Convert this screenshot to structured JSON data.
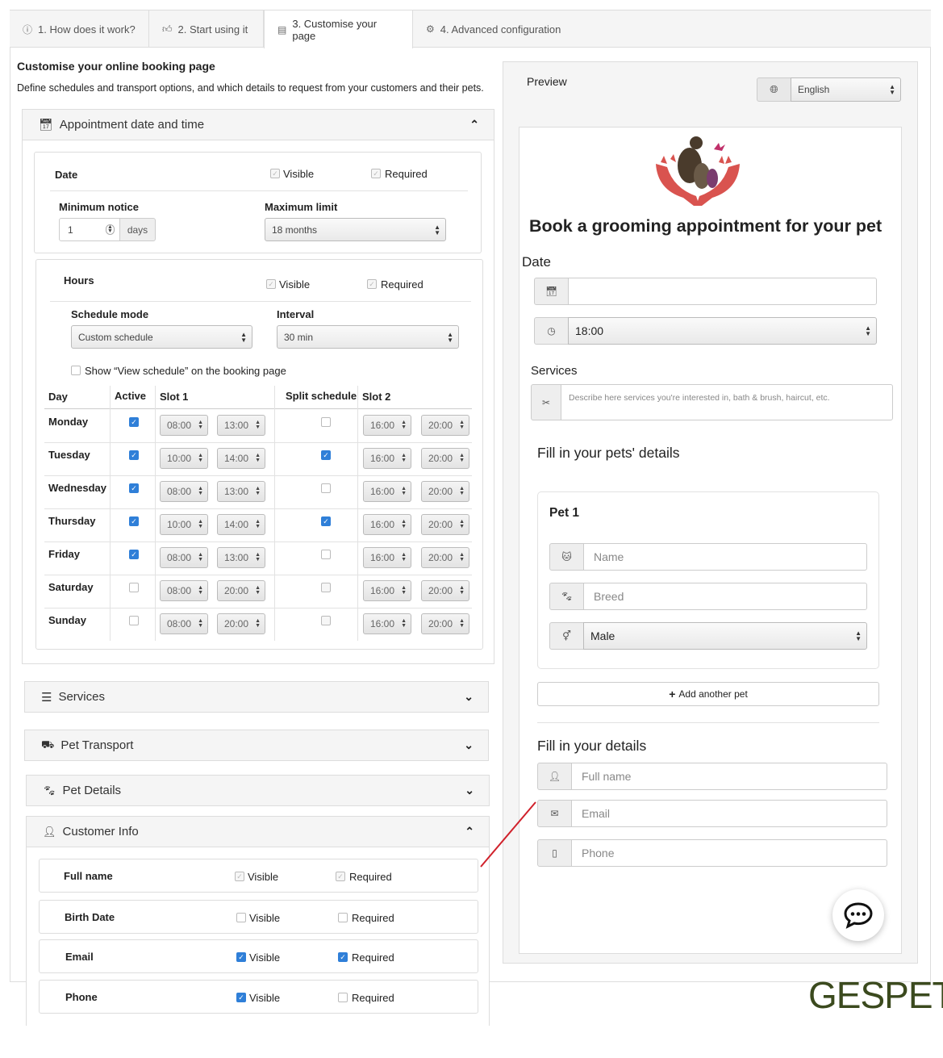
{
  "tabs": [
    {
      "icon": "info-circle-icon",
      "label": "1. How does it work?"
    },
    {
      "icon": "thumbs-up-icon",
      "label": "2. Start using it"
    },
    {
      "icon": "page-icon",
      "label": "3. Customise your page"
    },
    {
      "icon": "gears-icon",
      "label": "4. Advanced configuration"
    }
  ],
  "left": {
    "title": "Customise your online booking page",
    "subtitle": "Define schedules and transport options, and which details to request from your customers and their pets.",
    "appointment": {
      "header": "Appointment date and time",
      "date_label": "Date",
      "visible": "Visible",
      "required": "Required",
      "min_notice_label": "Minimum notice",
      "min_notice_value": "1",
      "days": "days",
      "max_limit_label": "Maximum limit",
      "max_limit_value": "18 months",
      "hours_label": "Hours",
      "schedule_mode_label": "Schedule mode",
      "schedule_mode_value": "Custom schedule",
      "interval_label": "Interval",
      "interval_value": "30 min",
      "show_view_schedule": "Show “View schedule” on the booking page",
      "col_day": "Day",
      "col_active": "Active",
      "col_slot1": "Slot 1",
      "col_split": "Split schedule",
      "col_slot2": "Slot 2",
      "days_rows": [
        {
          "day": "Monday",
          "active": true,
          "s1a": "08:00",
          "s1b": "13:00",
          "split": false,
          "s2a": "16:00",
          "s2b": "20:00"
        },
        {
          "day": "Tuesday",
          "active": true,
          "s1a": "10:00",
          "s1b": "14:00",
          "split": true,
          "s2a": "16:00",
          "s2b": "20:00"
        },
        {
          "day": "Wednesday",
          "active": true,
          "s1a": "08:00",
          "s1b": "13:00",
          "split": false,
          "s2a": "16:00",
          "s2b": "20:00"
        },
        {
          "day": "Thursday",
          "active": true,
          "s1a": "10:00",
          "s1b": "14:00",
          "split": true,
          "s2a": "16:00",
          "s2b": "20:00"
        },
        {
          "day": "Friday",
          "active": true,
          "s1a": "08:00",
          "s1b": "13:00",
          "split": false,
          "s2a": "16:00",
          "s2b": "20:00"
        },
        {
          "day": "Saturday",
          "active": false,
          "s1a": "08:00",
          "s1b": "20:00",
          "split": false,
          "s2a": "16:00",
          "s2b": "20:00"
        },
        {
          "day": "Sunday",
          "active": false,
          "s1a": "08:00",
          "s1b": "20:00",
          "split": false,
          "s2a": "16:00",
          "s2b": "20:00"
        }
      ]
    },
    "services_header": "Services",
    "transport_header": "Pet Transport",
    "pet_details_header": "Pet Details",
    "customer_info": {
      "header": "Customer Info",
      "rows": [
        {
          "label": "Full name",
          "visible": "Visible",
          "required": "Required",
          "vis_on": true,
          "req_on": true,
          "disabled": true
        },
        {
          "label": "Birth Date",
          "visible": "Visible",
          "required": "Required",
          "vis_on": false,
          "req_on": false,
          "disabled": false
        },
        {
          "label": "Email",
          "visible": "Visible",
          "required": "Required",
          "vis_on": true,
          "req_on": true,
          "disabled": false
        },
        {
          "label": "Phone",
          "visible": "Visible",
          "required": "Required",
          "vis_on": true,
          "req_on": false,
          "disabled": false
        }
      ]
    }
  },
  "preview": {
    "label": "Preview",
    "language": "English",
    "heading": "Book a grooming appointment for your pet",
    "date_label": "Date",
    "time_value": "18:00",
    "services_label": "Services",
    "services_placeholder": "Describe here services you're interested in, bath & brush, haircut, etc.",
    "pets_heading": "Fill in your pets' details",
    "pet_title": "Pet 1",
    "name_placeholder": "Name",
    "breed_placeholder": "Breed",
    "sex_value": "Male",
    "add_pet": "Add another pet",
    "details_heading": "Fill in your details",
    "fullname_placeholder": "Full name",
    "email_placeholder": "Email",
    "phone_placeholder": "Phone"
  },
  "brand": "GESPET",
  "colors": {
    "accent": "#2f7fd8",
    "logo_hands": "#d9534f",
    "brand": "#3b4a1e",
    "annotation_line": "#d0212b"
  }
}
